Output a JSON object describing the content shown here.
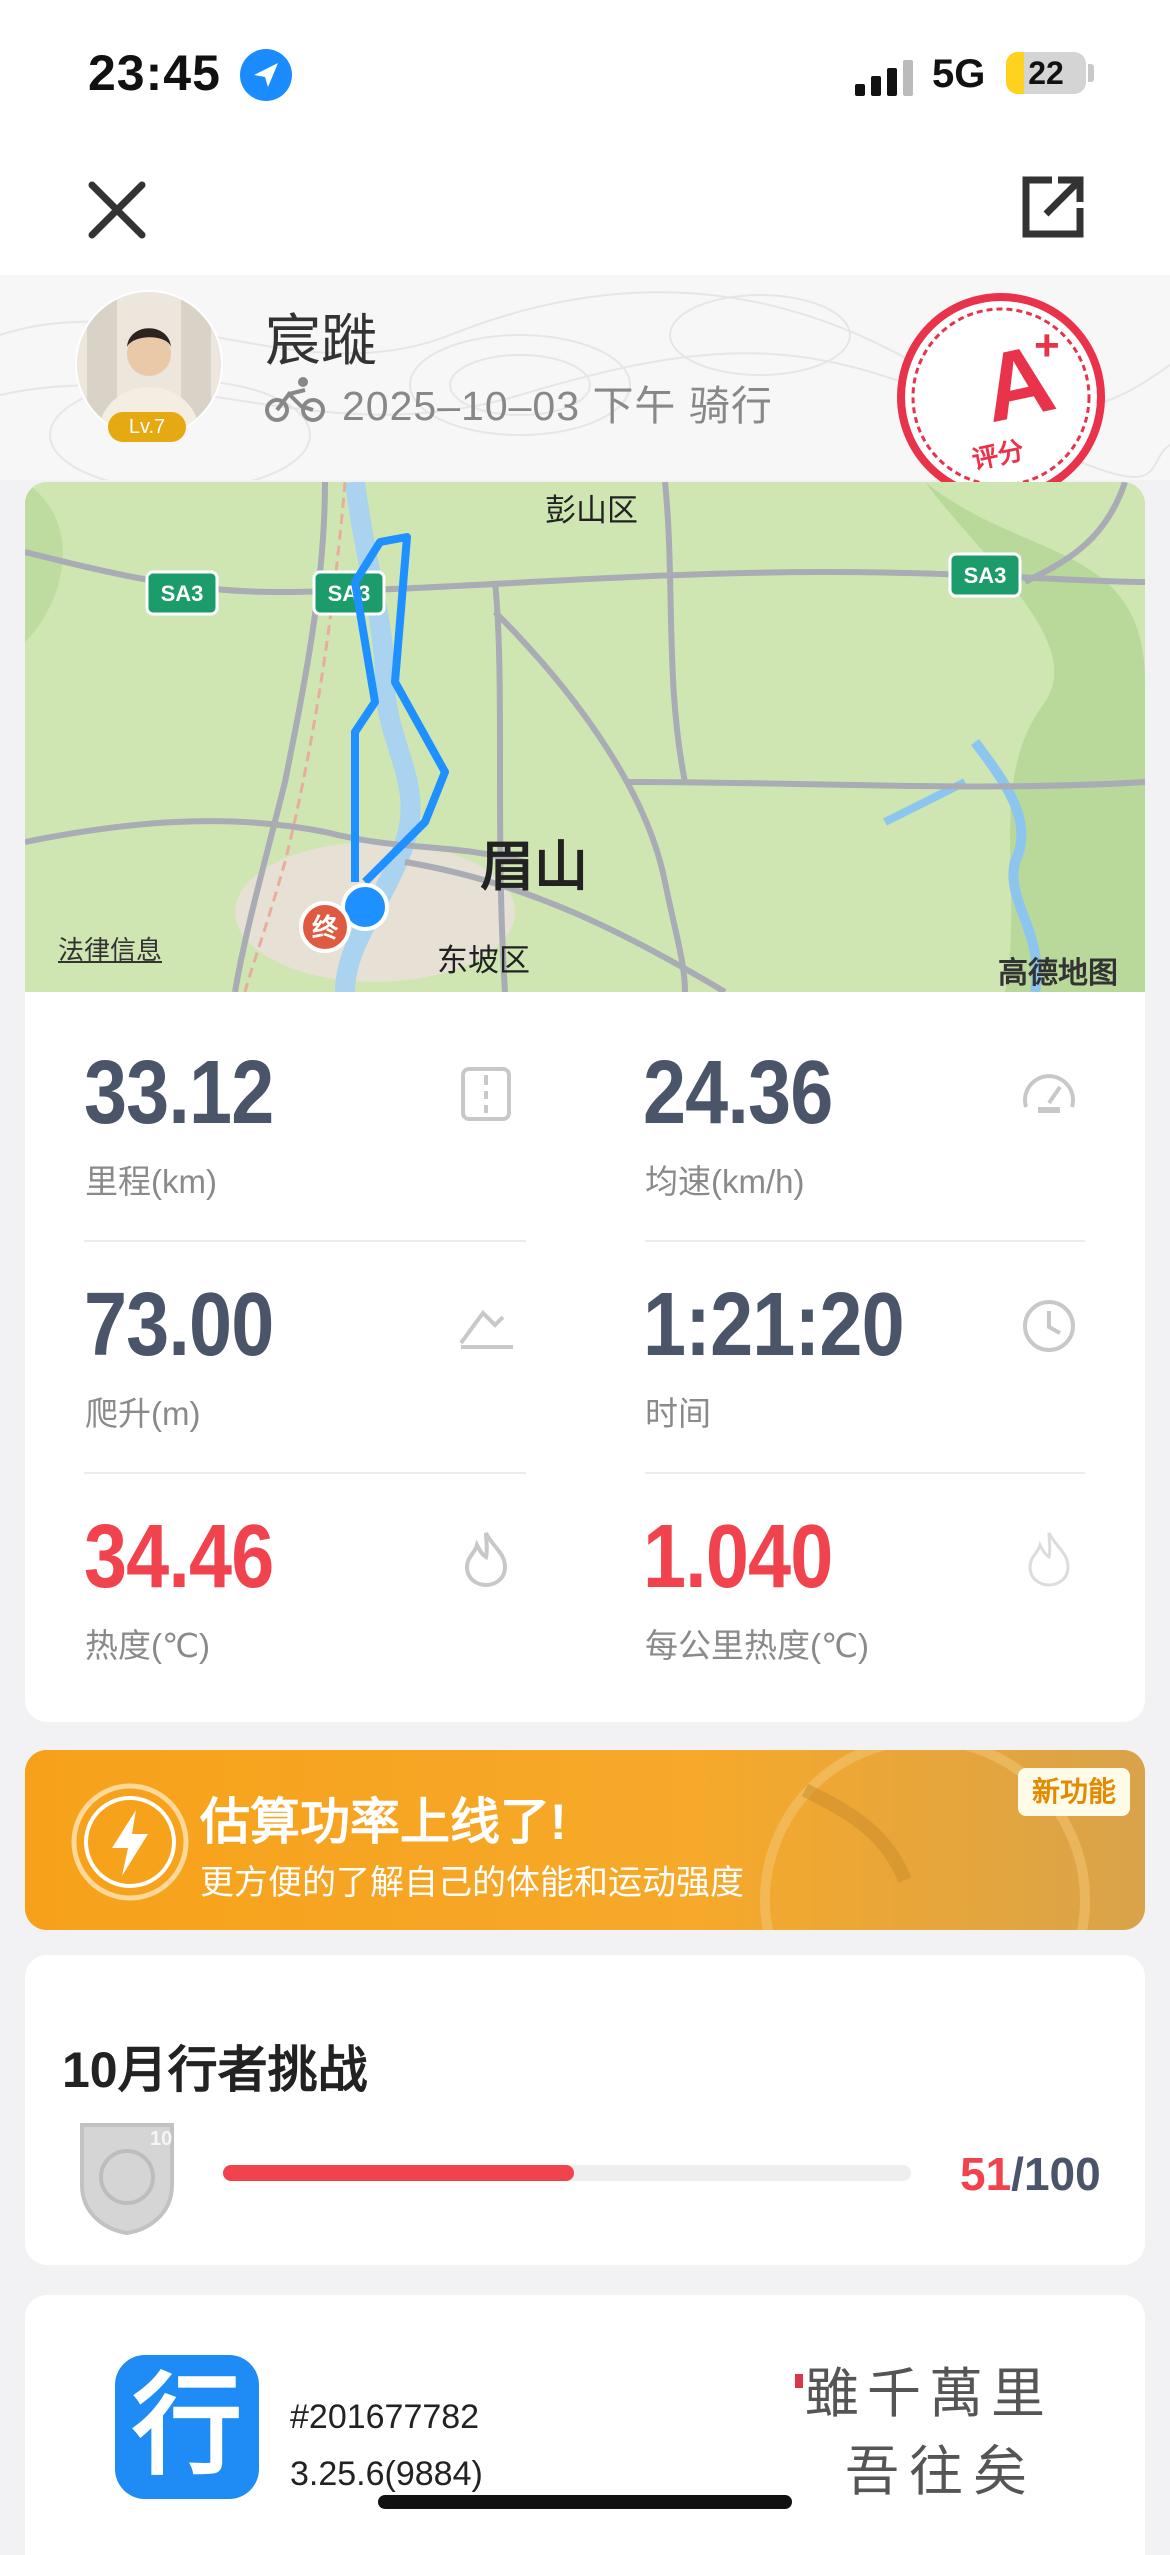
{
  "status_bar": {
    "time": "23:45",
    "network": "5G",
    "battery": "22",
    "battery_level_pct": 22
  },
  "nav": {
    "close_icon": "close-icon",
    "share_icon": "share-icon"
  },
  "profile": {
    "name": "宸蹝",
    "level": "Lv.7",
    "date": "2025–10–03",
    "period": "下午",
    "activity": "骑行",
    "grade": "A",
    "grade_plus": "+",
    "grade_label": "评分"
  },
  "map": {
    "labels": {
      "pengshan": "彭山区",
      "meishan": "眉山",
      "dongpo": "东坡区",
      "end_marker": "终",
      "road_sa3_1": "SA3",
      "road_sa3_2": "SA3",
      "road_sa3_3": "SA3"
    },
    "legal": "法律信息",
    "provider": "高德地图"
  },
  "stats": {
    "distance": {
      "value": "33.12",
      "label": "里程(km)"
    },
    "avg_speed": {
      "value": "24.36",
      "label": "均速(km/h)"
    },
    "climb": {
      "value": "73.00",
      "label": "爬升(m)"
    },
    "duration": {
      "value": "1:21:20",
      "label": "时间"
    },
    "heat": {
      "value": "34.46",
      "label": "热度(℃)"
    },
    "heat_per_km": {
      "value": "1.040",
      "label": "每公里热度(℃)"
    }
  },
  "promo": {
    "title": "估算功率上线了!",
    "subtitle": "更方便的了解自己的体能和运动强度",
    "badge": "新功能"
  },
  "challenge": {
    "title": "10月行者挑战",
    "done": "51",
    "separator": "/",
    "total": "100",
    "progress": 0.51
  },
  "footer": {
    "app_icon_char": "行",
    "record_id": "#201677782",
    "version": "3.25.6(9884)",
    "calligraphy_line1": "雖千萬里",
    "calligraphy_line2": "吾往矣"
  },
  "colors": {
    "accent_red": "#f0434d",
    "stat_gray": "#4a5569",
    "promo_orange": "#f7a21b",
    "route_blue": "#1e90ff",
    "app_blue": "#1f8cf5"
  }
}
